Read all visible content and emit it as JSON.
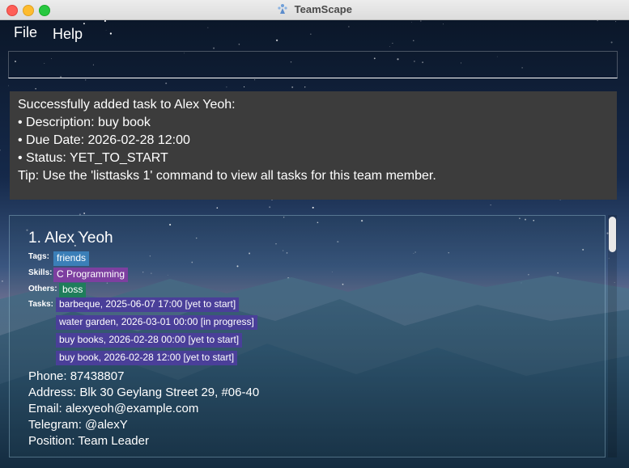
{
  "window": {
    "title": "TeamScape"
  },
  "menu": {
    "file": "File",
    "help": "Help"
  },
  "command": {
    "value": "",
    "placeholder": ""
  },
  "result": {
    "lines": [
      "Successfully added task to Alex Yeoh:",
      "• Description: buy book",
      "• Due Date: 2026-02-28 12:00",
      "• Status: YET_TO_START",
      "Tip: Use the 'listtasks 1' command to view all tasks for this team member."
    ]
  },
  "person": {
    "name": "1. Alex Yeoh",
    "labels": {
      "tags": "Tags:",
      "skills": "Skills:",
      "others": "Others:",
      "tasks": "Tasks:"
    },
    "tags": [
      "friends"
    ],
    "skills": [
      "C Programming"
    ],
    "others": [
      "boss"
    ],
    "tasks": [
      "barbeque, 2025-06-07 17:00 [yet to start]",
      "water garden, 2026-03-01 00:00 [in progress]",
      "buy books, 2026-02-28 00:00 [yet to start]",
      "buy book, 2026-02-28 12:00 [yet to start]"
    ],
    "phone": "Phone: 87438807",
    "address": "Address: Blk 30 Geylang Street 29, #06-40",
    "email": "Email: alexyeoh@example.com",
    "telegram": "Telegram: @alexY",
    "position": "Position: Team Leader"
  },
  "colors": {
    "tag_chip": "#3b7fb8",
    "skill_chip": "#7d3fa0",
    "other_chip": "#1f7d5b",
    "task_chip": "#4a3f99",
    "result_bg": "#3c3c3c"
  }
}
